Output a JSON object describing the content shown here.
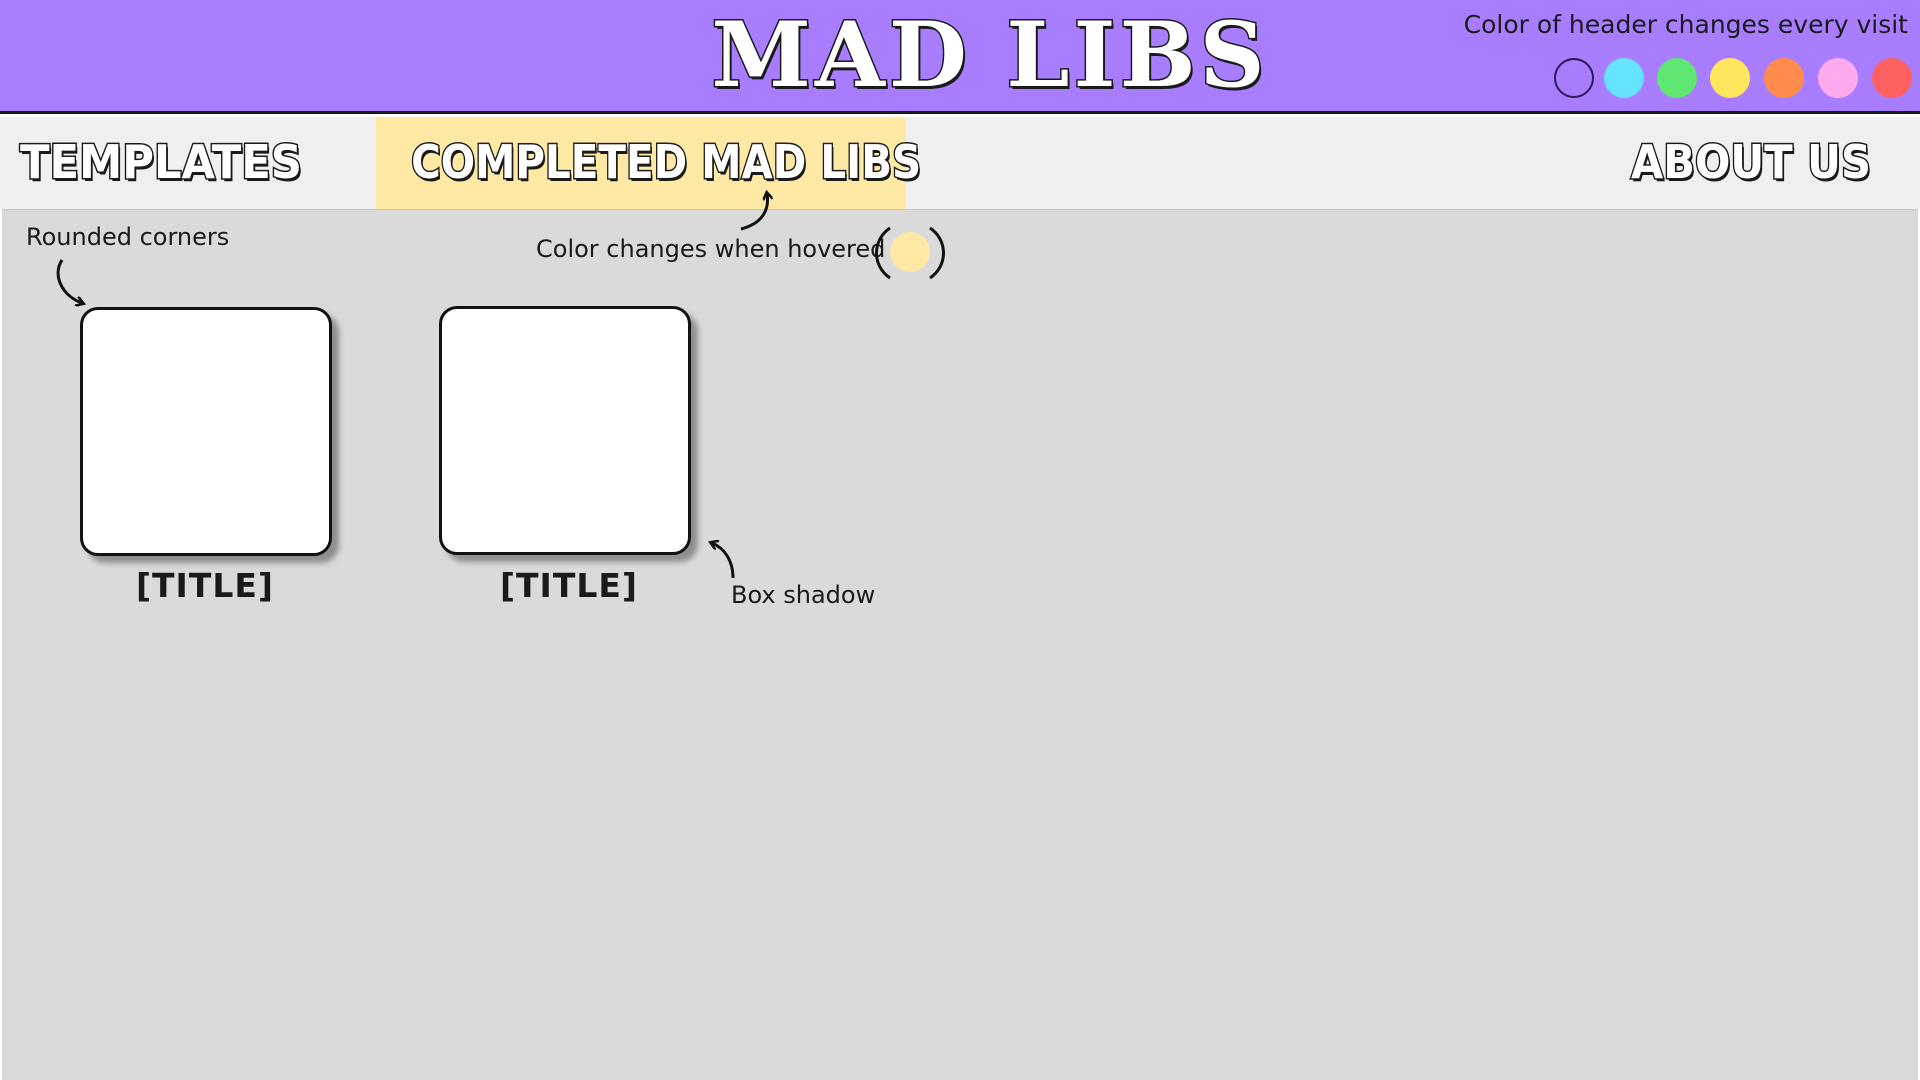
{
  "header": {
    "title": "MAD LIBS",
    "background_color": "#a97dff",
    "visit_note": "Color of header changes every visit",
    "swatches": [
      {
        "name": "purple",
        "color": "#a97dff"
      },
      {
        "name": "cyan",
        "color": "#66e3ff"
      },
      {
        "name": "green",
        "color": "#5ee873"
      },
      {
        "name": "yellow",
        "color": "#ffe65c"
      },
      {
        "name": "orange",
        "color": "#ff8c4d"
      },
      {
        "name": "pink",
        "color": "#ffaaee"
      },
      {
        "name": "red",
        "color": "#ff6060"
      }
    ]
  },
  "nav": {
    "templates": "TEMPLATES",
    "completed": "COMPLETED MAD LIBS",
    "about": "ABOUT US",
    "hover_color": "#fde9a3"
  },
  "cards": [
    {
      "title": "[TITLE]"
    },
    {
      "title": "[TITLE]"
    }
  ],
  "notes": {
    "rounded": "Rounded corners",
    "hover": "Color changes when hovered",
    "shadow": "Box shadow"
  }
}
